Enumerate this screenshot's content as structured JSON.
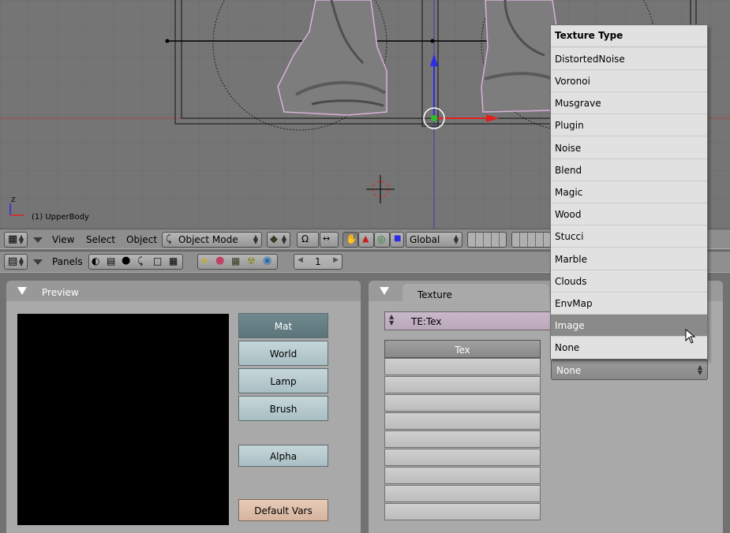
{
  "viewport": {
    "object_label": "(1) UpperBody",
    "axis_label": "Z",
    "axis_colors": {
      "x": "#e02020",
      "z": "#2c2ce6",
      "y": "#2ac02a"
    }
  },
  "header1": {
    "menu": {
      "view": "View",
      "select": "Select",
      "object": "Object"
    },
    "mode_select": "Object Mode",
    "orientation": "Global"
  },
  "header2": {
    "panels_label": "Panels",
    "frame": "1"
  },
  "preview_panel": {
    "title": "Preview",
    "buttons": [
      "Mat",
      "World",
      "Lamp",
      "Brush"
    ],
    "alpha": "Alpha",
    "default_vars": "Default Vars"
  },
  "texture_panel": {
    "tab": "Texture",
    "datablock": "TE:Tex",
    "list_header": "Tex",
    "type_value": "None"
  },
  "popup": {
    "title": "Texture Type",
    "items": [
      "DistortedNoise",
      "Voronoi",
      "Musgrave",
      "Plugin",
      "Noise",
      "Blend",
      "Magic",
      "Wood",
      "Stucci",
      "Marble",
      "Clouds",
      "EnvMap",
      "Image",
      "None"
    ],
    "highlighted": "Image"
  }
}
